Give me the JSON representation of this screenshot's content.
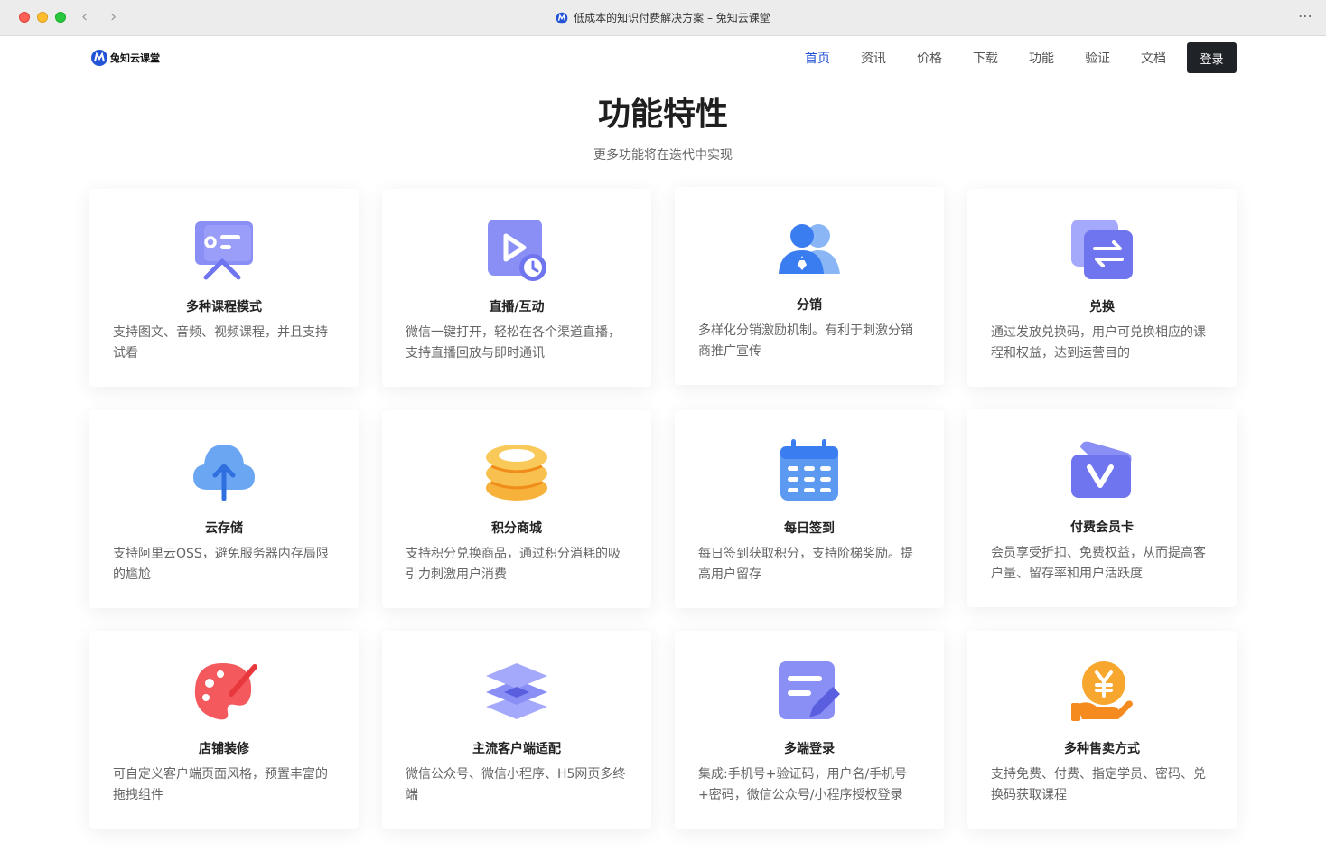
{
  "window": {
    "title": "低成本的知识付费解决方案 – 兔知云课堂"
  },
  "header": {
    "logo_text": "兔知云课堂",
    "menu": [
      "首页",
      "资讯",
      "价格",
      "下载",
      "功能",
      "验证",
      "文档"
    ],
    "active_menu": "首页",
    "login_label": "登录"
  },
  "hero": {
    "title": "功能特性",
    "subtitle": "更多功能将在迭代中实现"
  },
  "features": [
    {
      "title": "多种课程模式",
      "desc": "支持图文、音频、视频课程，并且支持试看",
      "icon": "course-mode-icon"
    },
    {
      "title": "直播/互动",
      "desc": "微信一键打开，轻松在各个渠道直播，支持直播回放与即时通讯",
      "icon": "live-play-icon"
    },
    {
      "title": "分销",
      "desc": "多样化分销激励机制。有利于刺激分销商推广宣传",
      "icon": "distribution-users-icon"
    },
    {
      "title": "兑换",
      "desc": "通过发放兑换码，用户可兑换相应的课程和权益，达到运营目的",
      "icon": "exchange-icon"
    },
    {
      "title": "云存储",
      "desc": "支持阿里云OSS，避免服务器内存局限的尴尬",
      "icon": "cloud-upload-icon"
    },
    {
      "title": "积分商城",
      "desc": "支持积分兑换商品，通过积分消耗的吸引力刺激用户消费",
      "icon": "coins-stack-icon"
    },
    {
      "title": "每日签到",
      "desc": "每日签到获取积分，支持阶梯奖励。提高用户留存",
      "icon": "calendar-icon"
    },
    {
      "title": "付费会员卡",
      "desc": "会员享受折扣、免费权益，从而提高客户量、留存率和用户活跃度",
      "icon": "vip-card-icon"
    },
    {
      "title": "店铺装修",
      "desc": "可自定义客户端页面风格，预置丰富的拖拽组件",
      "icon": "palette-icon"
    },
    {
      "title": "主流客户端适配",
      "desc": "微信公众号、微信小程序、H5网页多终端",
      "icon": "layers-icon"
    },
    {
      "title": "多端登录",
      "desc": "集成:手机号+验证码，用户名/手机号+密码，微信公众号/小程序授权登录",
      "icon": "edit-note-icon"
    },
    {
      "title": "多种售卖方式",
      "desc": "支持免费、付费、指定学员、密码、兑换码获取课程",
      "icon": "yen-hand-icon"
    }
  ]
}
